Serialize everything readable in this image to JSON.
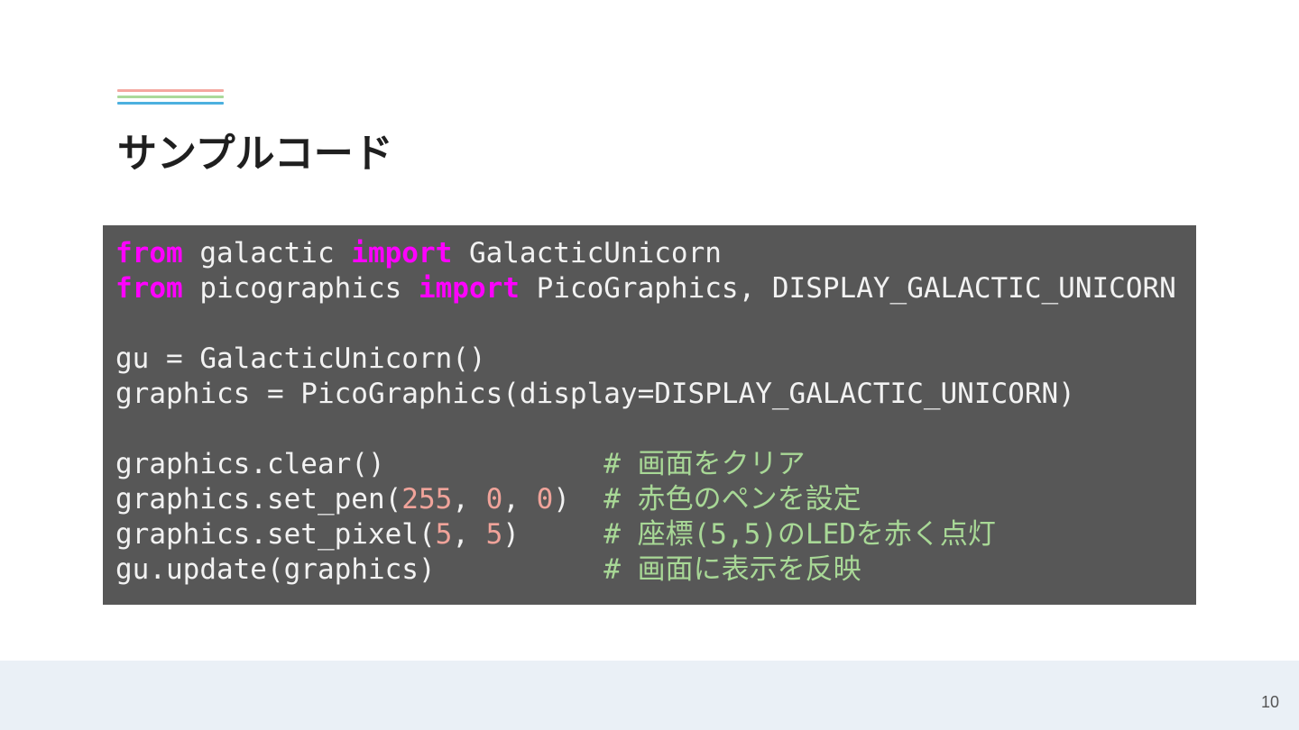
{
  "slide": {
    "title": "サンプルコード",
    "accent_colors": [
      "#f4a7a0",
      "#a9d99a",
      "#4cb0df"
    ],
    "page_number": "10"
  },
  "code": {
    "language": "python",
    "lines": [
      [
        {
          "t": "kw",
          "s": "from"
        },
        {
          "t": "tx",
          "s": " galactic "
        },
        {
          "t": "kw",
          "s": "import"
        },
        {
          "t": "tx",
          "s": " GalacticUnicorn"
        }
      ],
      [
        {
          "t": "kw",
          "s": "from"
        },
        {
          "t": "tx",
          "s": " picographics "
        },
        {
          "t": "kw",
          "s": "import"
        },
        {
          "t": "tx",
          "s": " PicoGraphics, DISPLAY_GALACTIC_UNICORN"
        }
      ],
      [],
      [
        {
          "t": "tx",
          "s": "gu = GalacticUnicorn()"
        }
      ],
      [
        {
          "t": "tx",
          "s": "graphics = PicoGraphics(display=DISPLAY_GALACTIC_UNICORN)"
        }
      ],
      [],
      [
        {
          "t": "tx",
          "s": "graphics.clear()             "
        },
        {
          "t": "cm",
          "s": "# 画面をクリア"
        }
      ],
      [
        {
          "t": "tx",
          "s": "graphics.set_pen("
        },
        {
          "t": "num",
          "s": "255"
        },
        {
          "t": "tx",
          "s": ", "
        },
        {
          "t": "num",
          "s": "0"
        },
        {
          "t": "tx",
          "s": ", "
        },
        {
          "t": "num",
          "s": "0"
        },
        {
          "t": "tx",
          "s": ")  "
        },
        {
          "t": "cm",
          "s": "# 赤色のペンを設定"
        }
      ],
      [
        {
          "t": "tx",
          "s": "graphics.set_pixel("
        },
        {
          "t": "num",
          "s": "5"
        },
        {
          "t": "tx",
          "s": ", "
        },
        {
          "t": "num",
          "s": "5"
        },
        {
          "t": "tx",
          "s": ")     "
        },
        {
          "t": "cm",
          "s": "# 座標(5,5)のLEDを赤く点灯"
        }
      ],
      [
        {
          "t": "tx",
          "s": "gu.update(graphics)          "
        },
        {
          "t": "cm",
          "s": "# 画面に表示を反映"
        }
      ]
    ]
  }
}
